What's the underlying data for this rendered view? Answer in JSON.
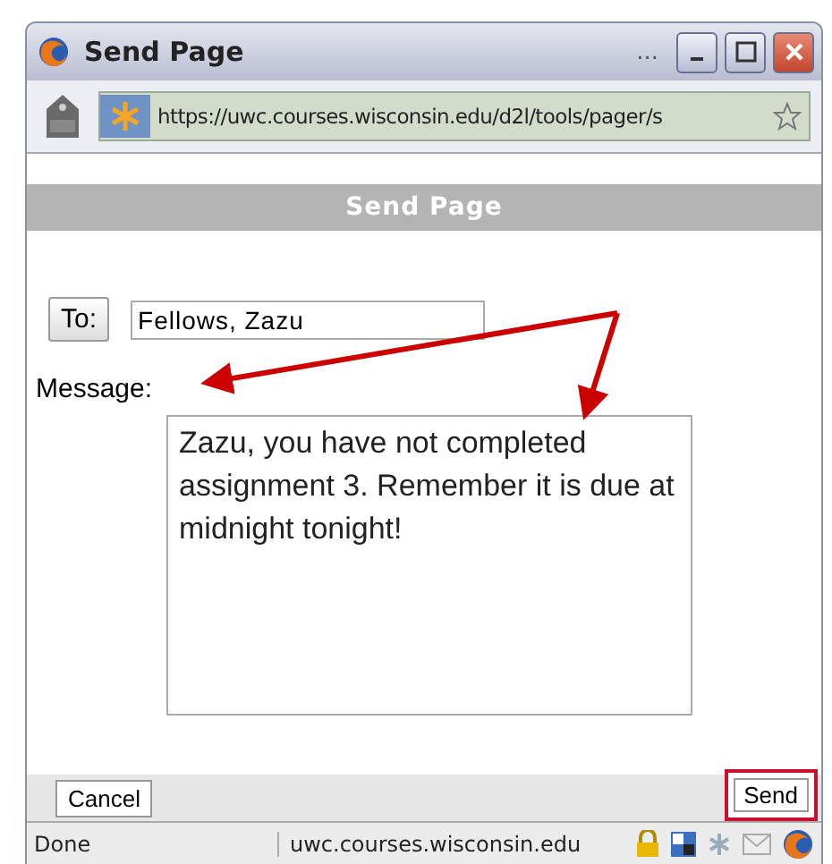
{
  "window": {
    "title": "Send Page",
    "ellipsis": "..."
  },
  "address_bar": {
    "url": "https://uwc.courses.wisconsin.edu/d2l/tools/pager/s"
  },
  "header": {
    "title": "Send Page"
  },
  "form": {
    "to_button": "To:",
    "to_value": "Fellows, Zazu",
    "message_label": "Message:",
    "message_value": "Zazu, you have not completed assignment 3. Remember it is due at midnight tonight!"
  },
  "buttons": [
    {
      "label": "Cancel",
      "highlighted": false
    },
    {
      "label": "Send",
      "highlighted": true
    }
  ],
  "status_bar": {
    "status": "Done",
    "domain": "uwc.courses.wisconsin.edu"
  }
}
